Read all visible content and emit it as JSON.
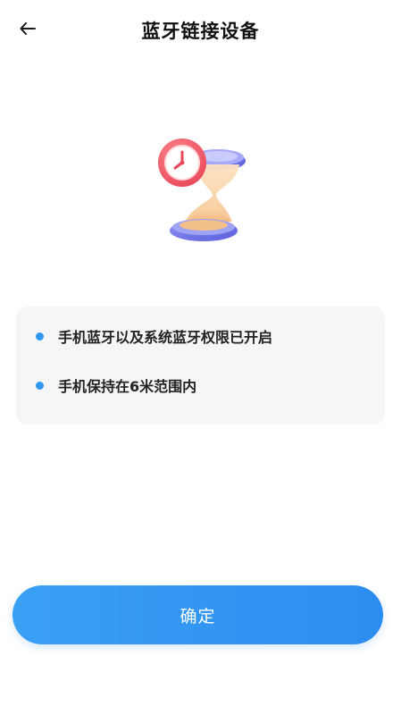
{
  "header": {
    "title": "蓝牙链接设备",
    "back_icon": "arrow-left-icon"
  },
  "illustration": {
    "icon": "hourglass-clock-icon"
  },
  "info": {
    "items": [
      {
        "text": "手机蓝牙以及系统蓝牙权限已开启"
      },
      {
        "text": "手机保持在6米范围内"
      }
    ]
  },
  "actions": {
    "confirm_label": "确定"
  },
  "colors": {
    "accent": "#2f96f4",
    "button_start": "#3aa0f4",
    "button_end": "#2c8df0",
    "card_background": "#f5f6f8",
    "clock_red": "#f0606a",
    "hourglass_cap": "#6e73e6"
  }
}
